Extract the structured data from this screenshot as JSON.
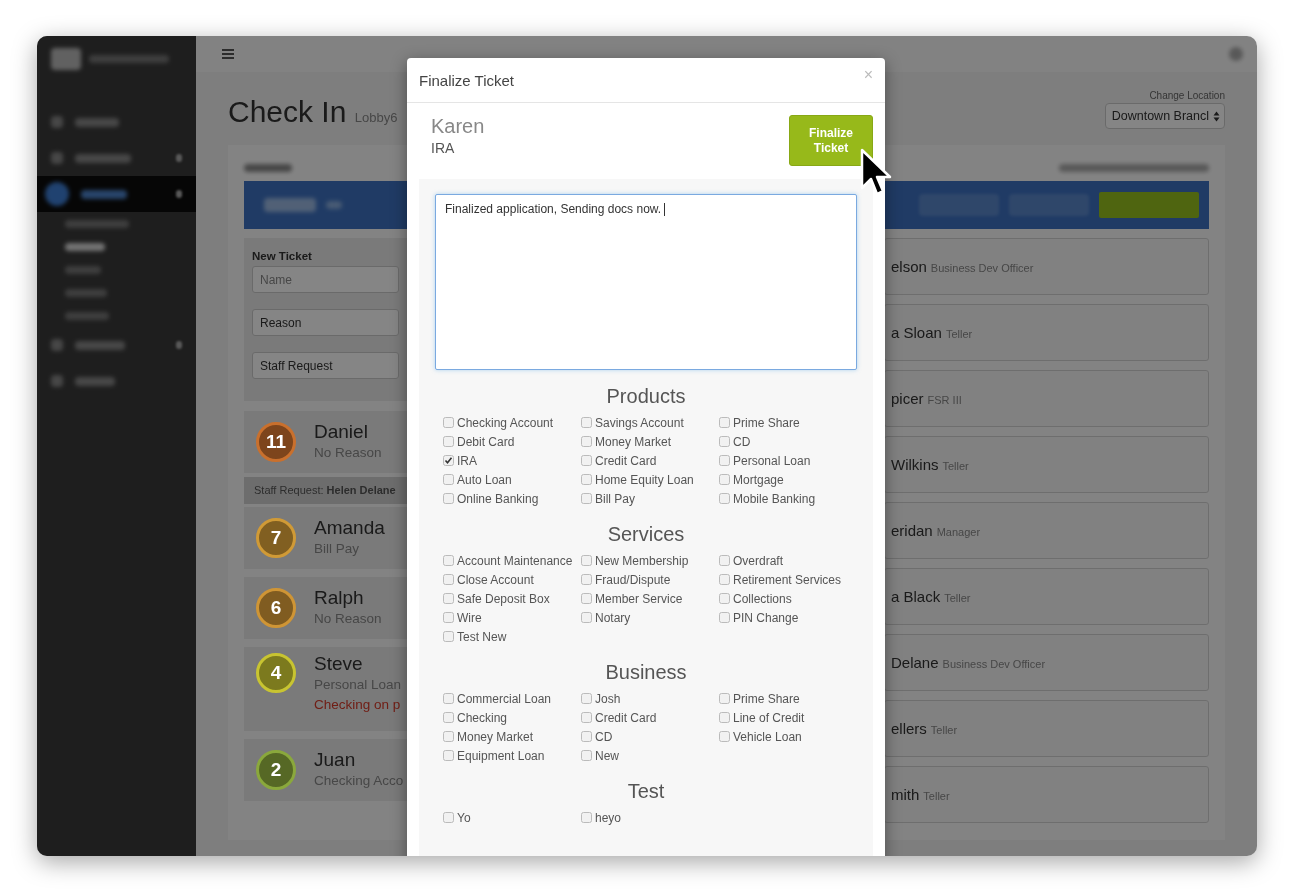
{
  "sidebar": {
    "items": [
      {
        "kind": "main",
        "selected": false,
        "chevron": false
      },
      {
        "kind": "main",
        "selected": false,
        "chevron": true
      },
      {
        "kind": "main",
        "selected": true,
        "chevron": true
      },
      {
        "kind": "sub",
        "selected": false,
        "chevron": false
      },
      {
        "kind": "sub",
        "selected": true,
        "chevron": false
      },
      {
        "kind": "sub",
        "selected": false,
        "chevron": false
      },
      {
        "kind": "sub",
        "selected": false,
        "chevron": false
      },
      {
        "kind": "sub",
        "selected": false,
        "chevron": false
      },
      {
        "kind": "main",
        "selected": false,
        "chevron": true
      },
      {
        "kind": "main",
        "selected": false,
        "chevron": false
      }
    ]
  },
  "page": {
    "title": "Check In",
    "subtitle": "Lobby6",
    "location_label": "Change Location",
    "location_value": "Downtown Brancl"
  },
  "new_ticket": {
    "heading": "New Ticket",
    "fields": [
      {
        "kind": "input",
        "placeholder": "Name"
      },
      {
        "kind": "select",
        "value": "Reason"
      },
      {
        "kind": "select",
        "value": "Staff Request"
      }
    ]
  },
  "queue": [
    {
      "kind": "ticket",
      "number": "11",
      "name": "Daniel",
      "reason": "No Reason",
      "color": "#c9702d"
    },
    {
      "kind": "request",
      "text": "Staff Request: **Helen Delane**"
    },
    {
      "kind": "ticket",
      "number": "7",
      "name": "Amanda",
      "reason": "Bill Pay",
      "color": "#d09a36"
    },
    {
      "kind": "ticket",
      "number": "6",
      "name": "Ralph",
      "reason": "No Reason",
      "color": "#cf9535"
    },
    {
      "kind": "ticket",
      "number": "4",
      "name": "Steve",
      "reason": "Personal Loan",
      "note": "Checking on p",
      "color": "#c8c431"
    },
    {
      "kind": "ticket",
      "number": "2",
      "name": "Juan",
      "reason": "Checking Acco",
      "color": "#8aa83c"
    }
  ],
  "staff": [
    {
      "name": "elson",
      "role": "Business Dev Officer"
    },
    {
      "name": "a Sloan",
      "role": "Teller"
    },
    {
      "name": "picer",
      "role": "FSR III"
    },
    {
      "name": "Wilkins",
      "role": "Teller"
    },
    {
      "name": "eridan",
      "role": "Manager"
    },
    {
      "name": "a Black",
      "role": "Teller"
    },
    {
      "name": "Delane",
      "role": "Business Dev Officer"
    },
    {
      "name": "ellers",
      "role": "Teller"
    },
    {
      "name": "mith",
      "role": "Teller"
    }
  ],
  "modal": {
    "title": "Finalize Ticket",
    "close": "×",
    "customer": "Karen",
    "product": "IRA",
    "button": "Finalize Ticket",
    "notes": "Finalized application, Sending docs now.",
    "sections": [
      {
        "heading": "Products",
        "options": [
          {
            "label": "Checking Account",
            "checked": false
          },
          {
            "label": "Savings Account",
            "checked": false
          },
          {
            "label": "Prime Share",
            "checked": false
          },
          {
            "label": "Debit Card",
            "checked": false
          },
          {
            "label": "Money Market",
            "checked": false
          },
          {
            "label": "CD",
            "checked": false
          },
          {
            "label": "IRA",
            "checked": true
          },
          {
            "label": "Credit Card",
            "checked": false
          },
          {
            "label": "Personal Loan",
            "checked": false
          },
          {
            "label": "Auto Loan",
            "checked": false
          },
          {
            "label": "Home Equity Loan",
            "checked": false
          },
          {
            "label": "Mortgage",
            "checked": false
          },
          {
            "label": "Online Banking",
            "checked": false
          },
          {
            "label": "Bill Pay",
            "checked": false
          },
          {
            "label": "Mobile Banking",
            "checked": false
          }
        ]
      },
      {
        "heading": "Services",
        "options": [
          {
            "label": "Account Maintenance",
            "checked": false
          },
          {
            "label": "New Membership",
            "checked": false
          },
          {
            "label": "Overdraft",
            "checked": false
          },
          {
            "label": "Close Account",
            "checked": false
          },
          {
            "label": "Fraud/Dispute",
            "checked": false
          },
          {
            "label": "Retirement Services",
            "checked": false
          },
          {
            "label": "Safe Deposit Box",
            "checked": false
          },
          {
            "label": "Member Service",
            "checked": false
          },
          {
            "label": "Collections",
            "checked": false
          },
          {
            "label": "Wire",
            "checked": false
          },
          {
            "label": "Notary",
            "checked": false
          },
          {
            "label": "PIN Change",
            "checked": false
          },
          {
            "label": "Test New",
            "checked": false
          }
        ]
      },
      {
        "heading": "Business",
        "options": [
          {
            "label": "Commercial Loan",
            "checked": false
          },
          {
            "label": "Josh",
            "checked": false
          },
          {
            "label": "Prime Share",
            "checked": false
          },
          {
            "label": "Checking",
            "checked": false
          },
          {
            "label": "Credit Card",
            "checked": false
          },
          {
            "label": "Line of Credit",
            "checked": false
          },
          {
            "label": "Money Market",
            "checked": false
          },
          {
            "label": "CD",
            "checked": false
          },
          {
            "label": "Vehicle Loan",
            "checked": false
          },
          {
            "label": "Equipment Loan",
            "checked": false
          },
          {
            "label": "New",
            "checked": false
          }
        ]
      },
      {
        "heading": "Test",
        "options": [
          {
            "label": "Yo",
            "checked": false
          },
          {
            "label": "heyo",
            "checked": false
          }
        ]
      }
    ]
  }
}
